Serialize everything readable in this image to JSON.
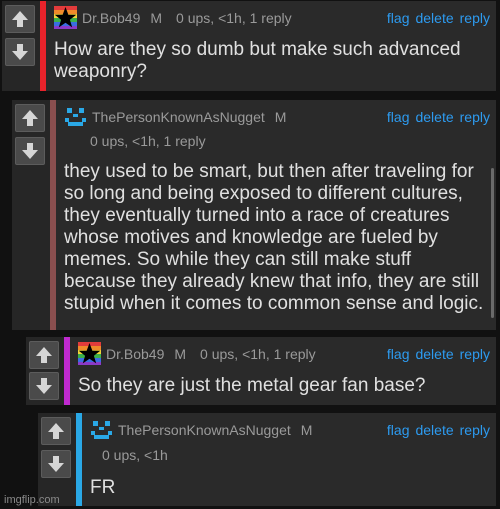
{
  "comments": [
    {
      "username": "Dr.Bob49",
      "badge": "M",
      "stats": "0 ups, <1h, 1 reply",
      "actions": {
        "flag": "flag",
        "delete": "delete",
        "reply": "reply"
      },
      "text": "How are they so dumb but make such advanced weaponry?",
      "bar_color": "#e8232b",
      "avatar_icon": "rainbow-star-avatar-icon"
    },
    {
      "username": "ThePersonKnownAsNugget",
      "badge": "M",
      "stats": "0 ups, <1h, 1 reply",
      "actions": {
        "flag": "flag",
        "delete": "delete",
        "reply": "reply"
      },
      "text": "they used to be smart, but then after traveling for so long and being exposed to different cultures, they eventually turned into a race of creatures whose motives and knowledge are fueled by memes. So while they can still make stuff because they already knew that info, they are still stupid when it comes to common sense and logic.",
      "bar_color": "#8a4f4f",
      "avatar_icon": "pixel-smiley-avatar-icon"
    },
    {
      "username": "Dr.Bob49",
      "badge": "M",
      "stats": "0 ups, <1h, 1 reply",
      "actions": {
        "flag": "flag",
        "delete": "delete",
        "reply": "reply"
      },
      "text": "So they are just the metal gear fan base?",
      "bar_color": "#c02ad0",
      "avatar_icon": "rainbow-star-avatar-icon"
    },
    {
      "username": "ThePersonKnownAsNugget",
      "badge": "M",
      "stats": "0 ups, <1h",
      "actions": {
        "flag": "flag",
        "delete": "delete",
        "reply": "reply"
      },
      "text": "FR",
      "bar_color": "#2aa8e6",
      "avatar_icon": "pixel-smiley-avatar-icon"
    }
  ],
  "watermark": "imgflip.com",
  "colors": {
    "background": "#111111",
    "card": "#2a2a2a",
    "link": "#2d9bf0",
    "text": "#e0e0e0",
    "meta": "#9a9a9a"
  }
}
